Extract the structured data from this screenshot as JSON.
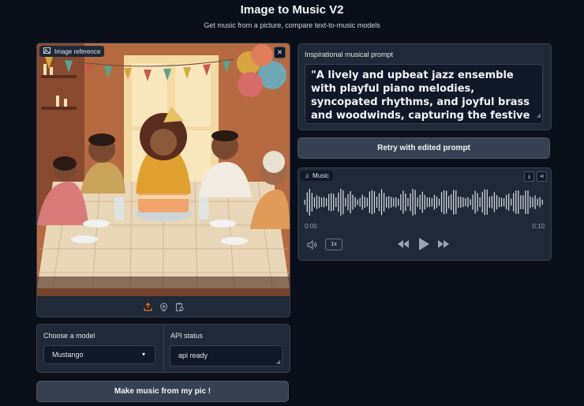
{
  "header": {
    "title": "Image to Music V2",
    "subtitle": "Get music from a picture, compare text-to-music models"
  },
  "image_panel": {
    "label": "Image reference",
    "label_icon": "image-icon",
    "close_icon": "close-icon",
    "close_glyph": "✕",
    "toolbar_icons": [
      "upload-icon",
      "webcam-icon",
      "clipboard-icon"
    ]
  },
  "model": {
    "label": "Choose a model",
    "selected": "Mustango",
    "caret": "▾"
  },
  "api_status": {
    "label": "API status",
    "value": "api ready"
  },
  "make_button": {
    "label": "Make music from my pic !"
  },
  "prompt": {
    "label": "Inspirational musical prompt",
    "value": "\"A lively and upbeat jazz ensemble with playful piano melodies, syncopated rhythms, and joyful brass and woodwinds, capturing the festive spirit of a birthday celebration in a cozy home setting\""
  },
  "retry_button": {
    "label": "Retry with edited prompt"
  },
  "audio": {
    "label": "Music",
    "label_icon": "music-note-icon",
    "label_glyph": "♫",
    "actions": [
      "download-icon",
      "share-icon"
    ],
    "action_glyphs": [
      "⤓",
      "⋖"
    ],
    "time_start": "0:00",
    "time_end": "0:10",
    "playback_rate": "1x",
    "controls": [
      "volume-icon",
      "rewind-icon",
      "play-icon",
      "fast-forward-icon"
    ]
  },
  "colors": {
    "background": "#0b0f19",
    "panel": "#1f2937",
    "border": "#374151",
    "input": "#111827",
    "button": "#374151",
    "accent": "#f97316",
    "waveform": "#d1d5db"
  }
}
